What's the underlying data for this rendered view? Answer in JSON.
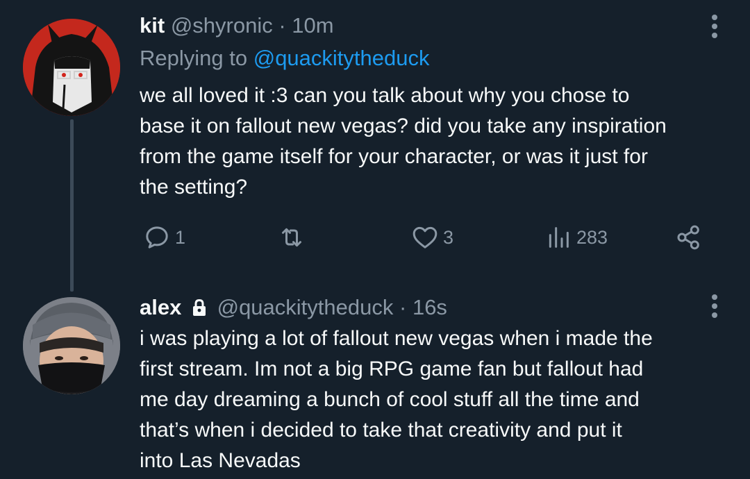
{
  "tweets": [
    {
      "name": "kit",
      "handle": "@shyronic",
      "separator": "·",
      "time": "10m",
      "replying_prefix": "Replying to",
      "replying_to": "@quackitytheduck",
      "body_lines": [
        "we all loved it :3 can you talk about why you chose to",
        "base it on fallout new vegas? did you take any inspiration",
        "from the game itself for your character, or was it just for",
        "the setting?"
      ],
      "actions": {
        "reply_count": "1",
        "retweet_count": "",
        "like_count": "3",
        "views_count": "283"
      },
      "avatar_icon": "avatar-drawn-character-icon"
    },
    {
      "name": "alex",
      "handle": "@quackitytheduck",
      "separator": "·",
      "time": "16s",
      "protected": true,
      "body_lines": [
        "i was playing a lot of fallout new vegas when i made the",
        "first stream. Im not a big RPG game fan but fallout had",
        "me day dreaming a bunch of cool stuff all the time and",
        "that’s when i decided to take that creativity and put it",
        "into Las Nevadas"
      ],
      "avatar_icon": "avatar-person-masked-icon"
    }
  ],
  "colors": {
    "background": "#15202b",
    "text": "#f7f9f9",
    "secondary": "#8b98a5",
    "link": "#1d9bf0",
    "thread_line": "#3c4a58"
  },
  "icons": [
    "reply-icon",
    "retweet-icon",
    "like-icon",
    "views-icon",
    "share-icon",
    "more-icon",
    "lock-icon"
  ]
}
